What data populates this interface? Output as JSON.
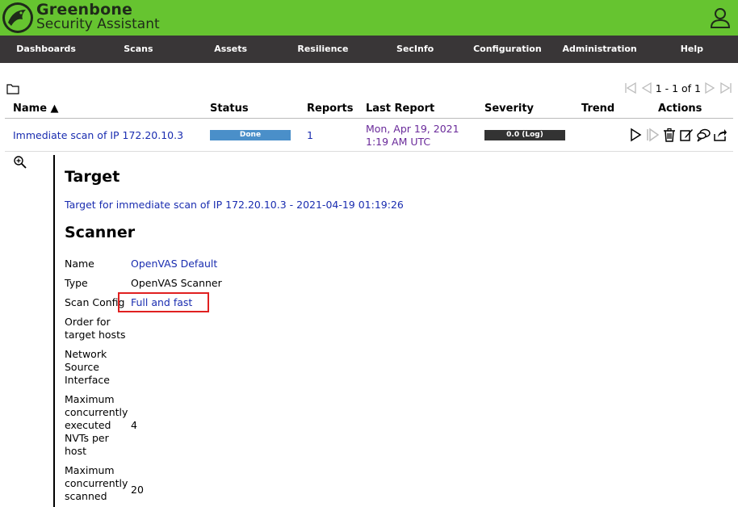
{
  "app": {
    "brand_line1": "Greenbone",
    "brand_line2": "Security Assistant"
  },
  "nav": {
    "items": [
      "Dashboards",
      "Scans",
      "Assets",
      "Resilience",
      "SecInfo",
      "Configuration",
      "Administration",
      "Help"
    ]
  },
  "pager": {
    "text": "1 - 1 of 1"
  },
  "table": {
    "headers": {
      "name": "Name ▲",
      "status": "Status",
      "reports": "Reports",
      "last_report": "Last Report",
      "severity": "Severity",
      "trend": "Trend",
      "actions": "Actions"
    },
    "row": {
      "name": "Immediate scan of IP 172.20.10.3",
      "status": "Done",
      "status_progress_percent": 100,
      "reports": "1",
      "last_report_line1": "Mon, Apr 19, 2021",
      "last_report_line2": "1:19 AM UTC",
      "severity": "0.0 (Log)"
    }
  },
  "details": {
    "target_heading": "Target",
    "target_link": "Target for immediate scan of IP 172.20.10.3 - 2021-04-19 01:19:26",
    "scanner_heading": "Scanner",
    "fields": {
      "name_label": "Name",
      "name_value": "OpenVAS Default",
      "type_label": "Type",
      "type_value": "OpenVAS Scanner",
      "scan_config_label": "Scan Config",
      "scan_config_value": "Full and fast",
      "order_label_1": "Order for",
      "order_label_2": "target hosts",
      "nsi_label_1": "Network",
      "nsi_label_2": "Source",
      "nsi_label_3": "Interface",
      "max_nvts_label_1": "Maximum",
      "max_nvts_label_2": "concurrently",
      "max_nvts_label_3": "executed",
      "max_nvts_label_4": "NVTs per",
      "max_nvts_label_5": "host",
      "max_nvts_value": "4",
      "max_hosts_label_1": "Maximum",
      "max_hosts_label_2": "concurrently",
      "max_hosts_label_3": "scanned",
      "max_hosts_value": "20"
    }
  },
  "colors": {
    "header_green": "#66c430",
    "nav_dark": "#393637",
    "status_done": "#4a8fc9",
    "severity_log": "#333333",
    "highlight": "#e02020"
  }
}
